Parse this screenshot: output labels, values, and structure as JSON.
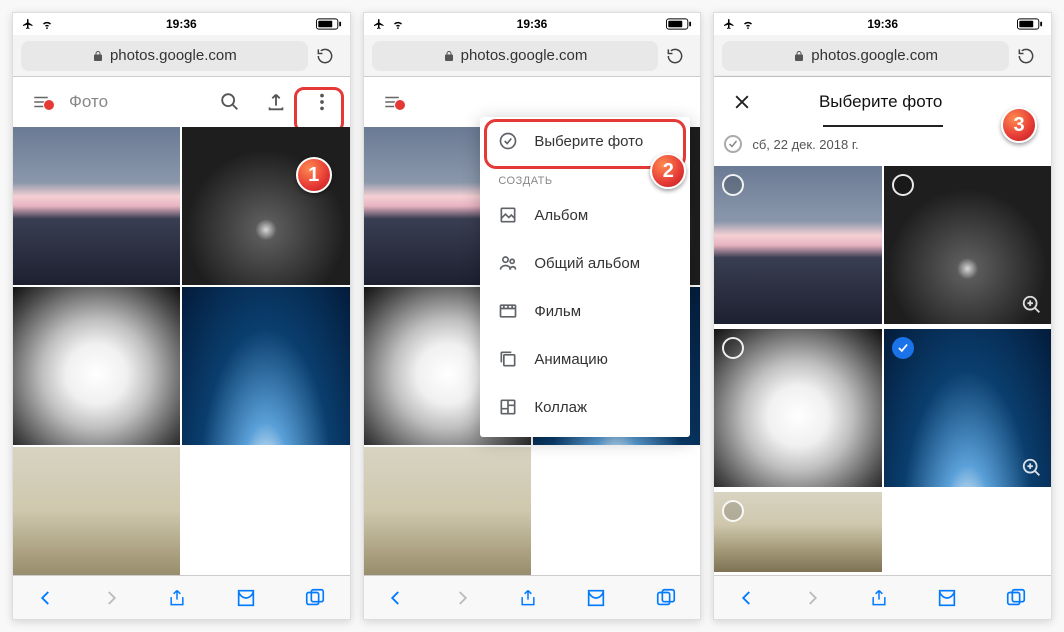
{
  "status": {
    "time": "19:36"
  },
  "url": "photos.google.com",
  "app": {
    "title_feed": "Фото",
    "title_select": "Выберите фото",
    "select_date": "сб, 22 дек. 2018 г."
  },
  "dropdown": {
    "select_photos": "Выберите фото",
    "section_create": "СОЗДАТЬ",
    "album": "Альбом",
    "shared_album": "Общий альбом",
    "movie": "Фильм",
    "animation": "Анимацию",
    "collage": "Коллаж"
  },
  "steps": {
    "s1": "1",
    "s2": "2",
    "s3": "3"
  }
}
